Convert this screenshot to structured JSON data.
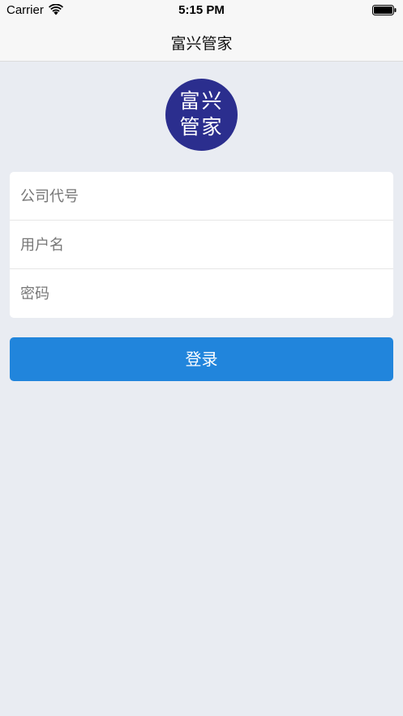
{
  "status_bar": {
    "carrier": "Carrier",
    "time": "5:15 PM",
    "wifi_icon": "wifi-icon",
    "battery_icon": "battery-full-icon"
  },
  "nav": {
    "title": "富兴管家"
  },
  "logo": {
    "line1": "富兴",
    "line2": "管家",
    "color": "#2b2e8e"
  },
  "form": {
    "company_code_placeholder": "公司代号",
    "username_placeholder": "用户名",
    "password_placeholder": "密码"
  },
  "login_button": {
    "label": "登录",
    "color": "#2185dc"
  },
  "colors": {
    "background": "#e9ecf2",
    "bar": "#f7f7f7"
  }
}
